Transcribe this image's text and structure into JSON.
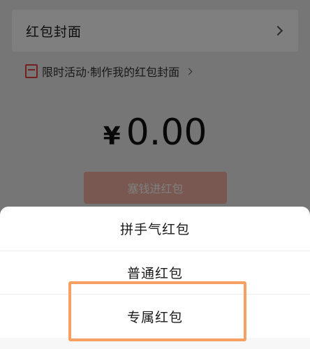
{
  "background": {
    "cover_row": {
      "label": "红包封面",
      "icon": "chevron-right-icon"
    },
    "promo": {
      "icon": "red-packet-cover-icon",
      "text": "限时活动·制作我的红包封面",
      "chevron": "chevron-right-icon"
    },
    "amount": {
      "currency": "¥",
      "value": "0.00"
    },
    "send_button": {
      "label": "塞钱进红包"
    }
  },
  "sheet": {
    "items": [
      {
        "label": "拼手气红包"
      },
      {
        "label": "普通红包"
      },
      {
        "label": "专属红包",
        "highlighted": true
      }
    ]
  },
  "colors": {
    "highlight": "#f7a061",
    "accent_red": "#e64340"
  }
}
